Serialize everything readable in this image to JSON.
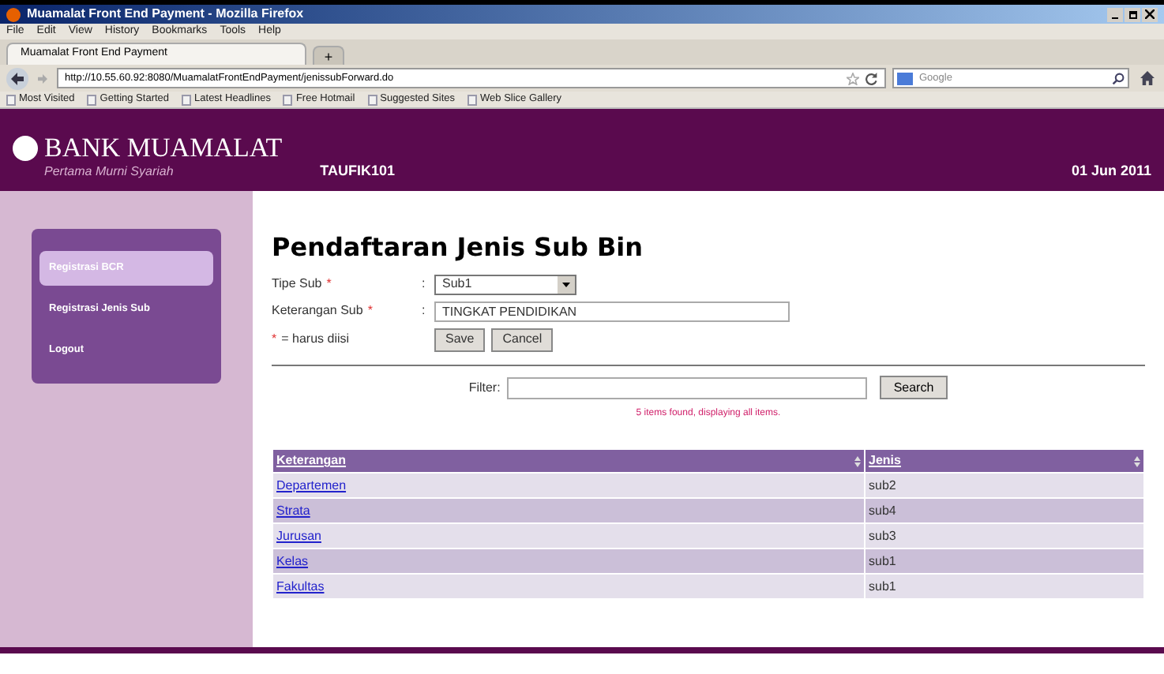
{
  "window": {
    "title": "Muamalat Front End Payment - Mozilla Firefox"
  },
  "menu": [
    "File",
    "Edit",
    "View",
    "History",
    "Bookmarks",
    "Tools",
    "Help"
  ],
  "tabs": [
    {
      "label": "Muamalat Front End Payment",
      "selected": true
    },
    {
      "label": "+",
      "selected": false
    }
  ],
  "address": {
    "value": "http://10.55.60.92:8080/MuamalatFrontEndPayment/jenissubForward.do"
  },
  "search_engine": {
    "placeholder": "Google"
  },
  "bookmarks": [
    "Most Visited",
    "Getting Started",
    "Latest Headlines",
    "Free Hotmail",
    "Suggested Sites",
    "Web Slice Gallery"
  ],
  "header": {
    "bank_name": "BANK MUAMALAT",
    "tagline": "Pertama Murni Syariah",
    "user": "TAUFIK101",
    "date": "01 Jun 2011"
  },
  "sidebar": {
    "items": [
      {
        "label": "Registrasi BCR",
        "selected": true
      },
      {
        "label": "Registrasi Jenis Sub",
        "selected": false
      },
      {
        "label": "Logout",
        "selected": false
      }
    ]
  },
  "form": {
    "title": "Pendaftaran Jenis Sub Bin",
    "fields": [
      {
        "label": "Tipe Sub",
        "required_mark": "*",
        "separator": ":",
        "kind": "select",
        "value": "Sub1"
      },
      {
        "label": "Keterangan Sub",
        "required_mark": "*",
        "separator": ":",
        "kind": "text",
        "value": "TINGKAT PENDIDIKAN"
      }
    ],
    "required_note": {
      "mark": "*",
      "text": "= harus diisi"
    },
    "buttons": [
      "Save",
      "Cancel"
    ]
  },
  "filter": {
    "label": "Filter:",
    "button": "Search"
  },
  "status": "5 items found, displaying all items.",
  "table": {
    "columns": [
      "Keterangan",
      "Jenis"
    ],
    "rows": [
      [
        "Departemen",
        "sub2"
      ],
      [
        "Strata",
        "sub4"
      ],
      [
        "Jurusan",
        "sub3"
      ],
      [
        "Kelas",
        "sub1"
      ],
      [
        "Fakultas",
        "sub1"
      ]
    ]
  }
}
